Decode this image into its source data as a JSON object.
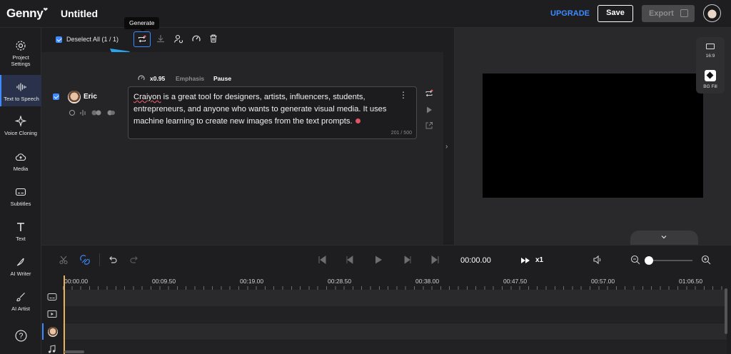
{
  "app": {
    "logo": "Genny",
    "title": "Untitled"
  },
  "header": {
    "upgrade": "UPGRADE",
    "save": "Save",
    "export": "Export"
  },
  "sidebar": {
    "items": [
      {
        "label": "Project Settings",
        "icon": "gear-icon"
      },
      {
        "label": "Text to Speech",
        "icon": "waveform-icon"
      },
      {
        "label": "Voice Cloning",
        "icon": "voice-clone-icon"
      },
      {
        "label": "Media",
        "icon": "cloud-upload-icon"
      },
      {
        "label": "Subtitles",
        "icon": "subtitles-icon"
      },
      {
        "label": "Text",
        "icon": "text-icon"
      },
      {
        "label": "AI Writer",
        "icon": "pen-icon"
      },
      {
        "label": "AI Artist",
        "icon": "brush-icon"
      }
    ],
    "help": "?"
  },
  "toolbar": {
    "deselect": "Deselect All (1 / 1)",
    "tooltip": "Generate",
    "icons": [
      "generate-icon",
      "download-icon",
      "speaker-settings-icon",
      "speed-icon",
      "trash-icon"
    ]
  },
  "block": {
    "speed": "x0.95",
    "emphasis": "Emphasis",
    "pause": "Pause",
    "speaker": "Eric",
    "text_prefix": "Craiyon",
    "text_rest": " is a great tool for designers, artists, influencers, students, entrepreneurs, and anyone who wants to generate visual media. It uses machine learning to create new images from the text prompts.",
    "counter": "201 / 500"
  },
  "preview": {
    "ratio": "16:9",
    "bg_fill": "BG Fill"
  },
  "timeline": {
    "time": "00:00.00",
    "speed": "x1",
    "ruler": [
      "00:00.00",
      "00:09.50",
      "00:19.00",
      "00:28.50",
      "00:38.00",
      "00:47.50",
      "00:57.00",
      "01:06.50"
    ]
  },
  "colors": {
    "accent": "#3d8bff",
    "background": "#1c1c1e",
    "error": "#e05563"
  }
}
